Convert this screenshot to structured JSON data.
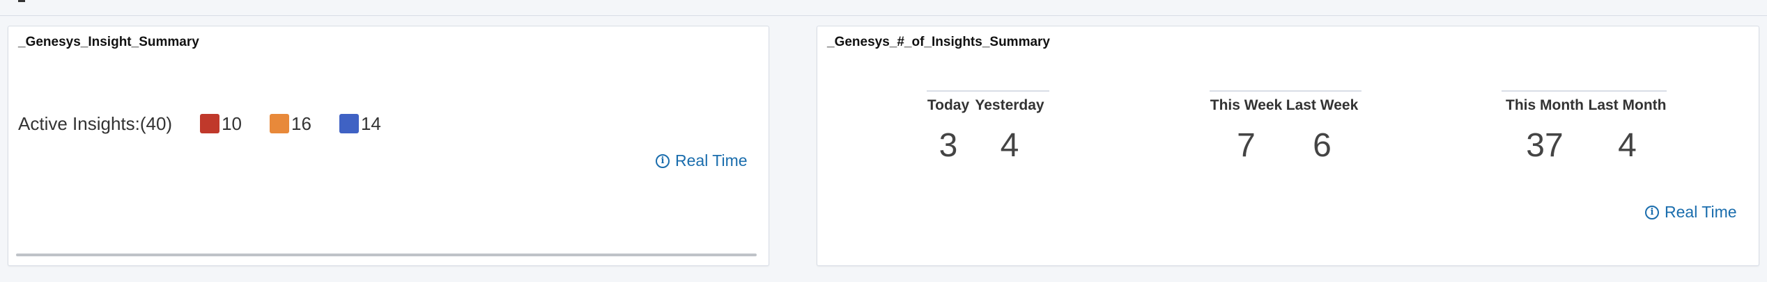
{
  "insight_summary": {
    "title": "_Genesys_Insight_Summary",
    "active_label": "Active Insights:(40)",
    "legend": [
      {
        "color": "#c0392b",
        "count": "10"
      },
      {
        "color": "#e8893a",
        "count": "16"
      },
      {
        "color": "#3f62c4",
        "count": "14"
      }
    ],
    "realtime_label": "Real Time"
  },
  "insights_count_summary": {
    "title": "_Genesys_#_of_Insights_Summary",
    "groups": [
      {
        "cols": [
          {
            "label": "Today",
            "value": "3"
          },
          {
            "label": "Yesterday",
            "value": "4"
          }
        ]
      },
      {
        "cols": [
          {
            "label": "This Week",
            "value": "7"
          },
          {
            "label": "Last Week",
            "value": "6"
          }
        ]
      },
      {
        "cols": [
          {
            "label": "This Month",
            "value": "37"
          },
          {
            "label": "Last Month",
            "value": "4"
          }
        ]
      }
    ],
    "realtime_label": "Real Time"
  }
}
